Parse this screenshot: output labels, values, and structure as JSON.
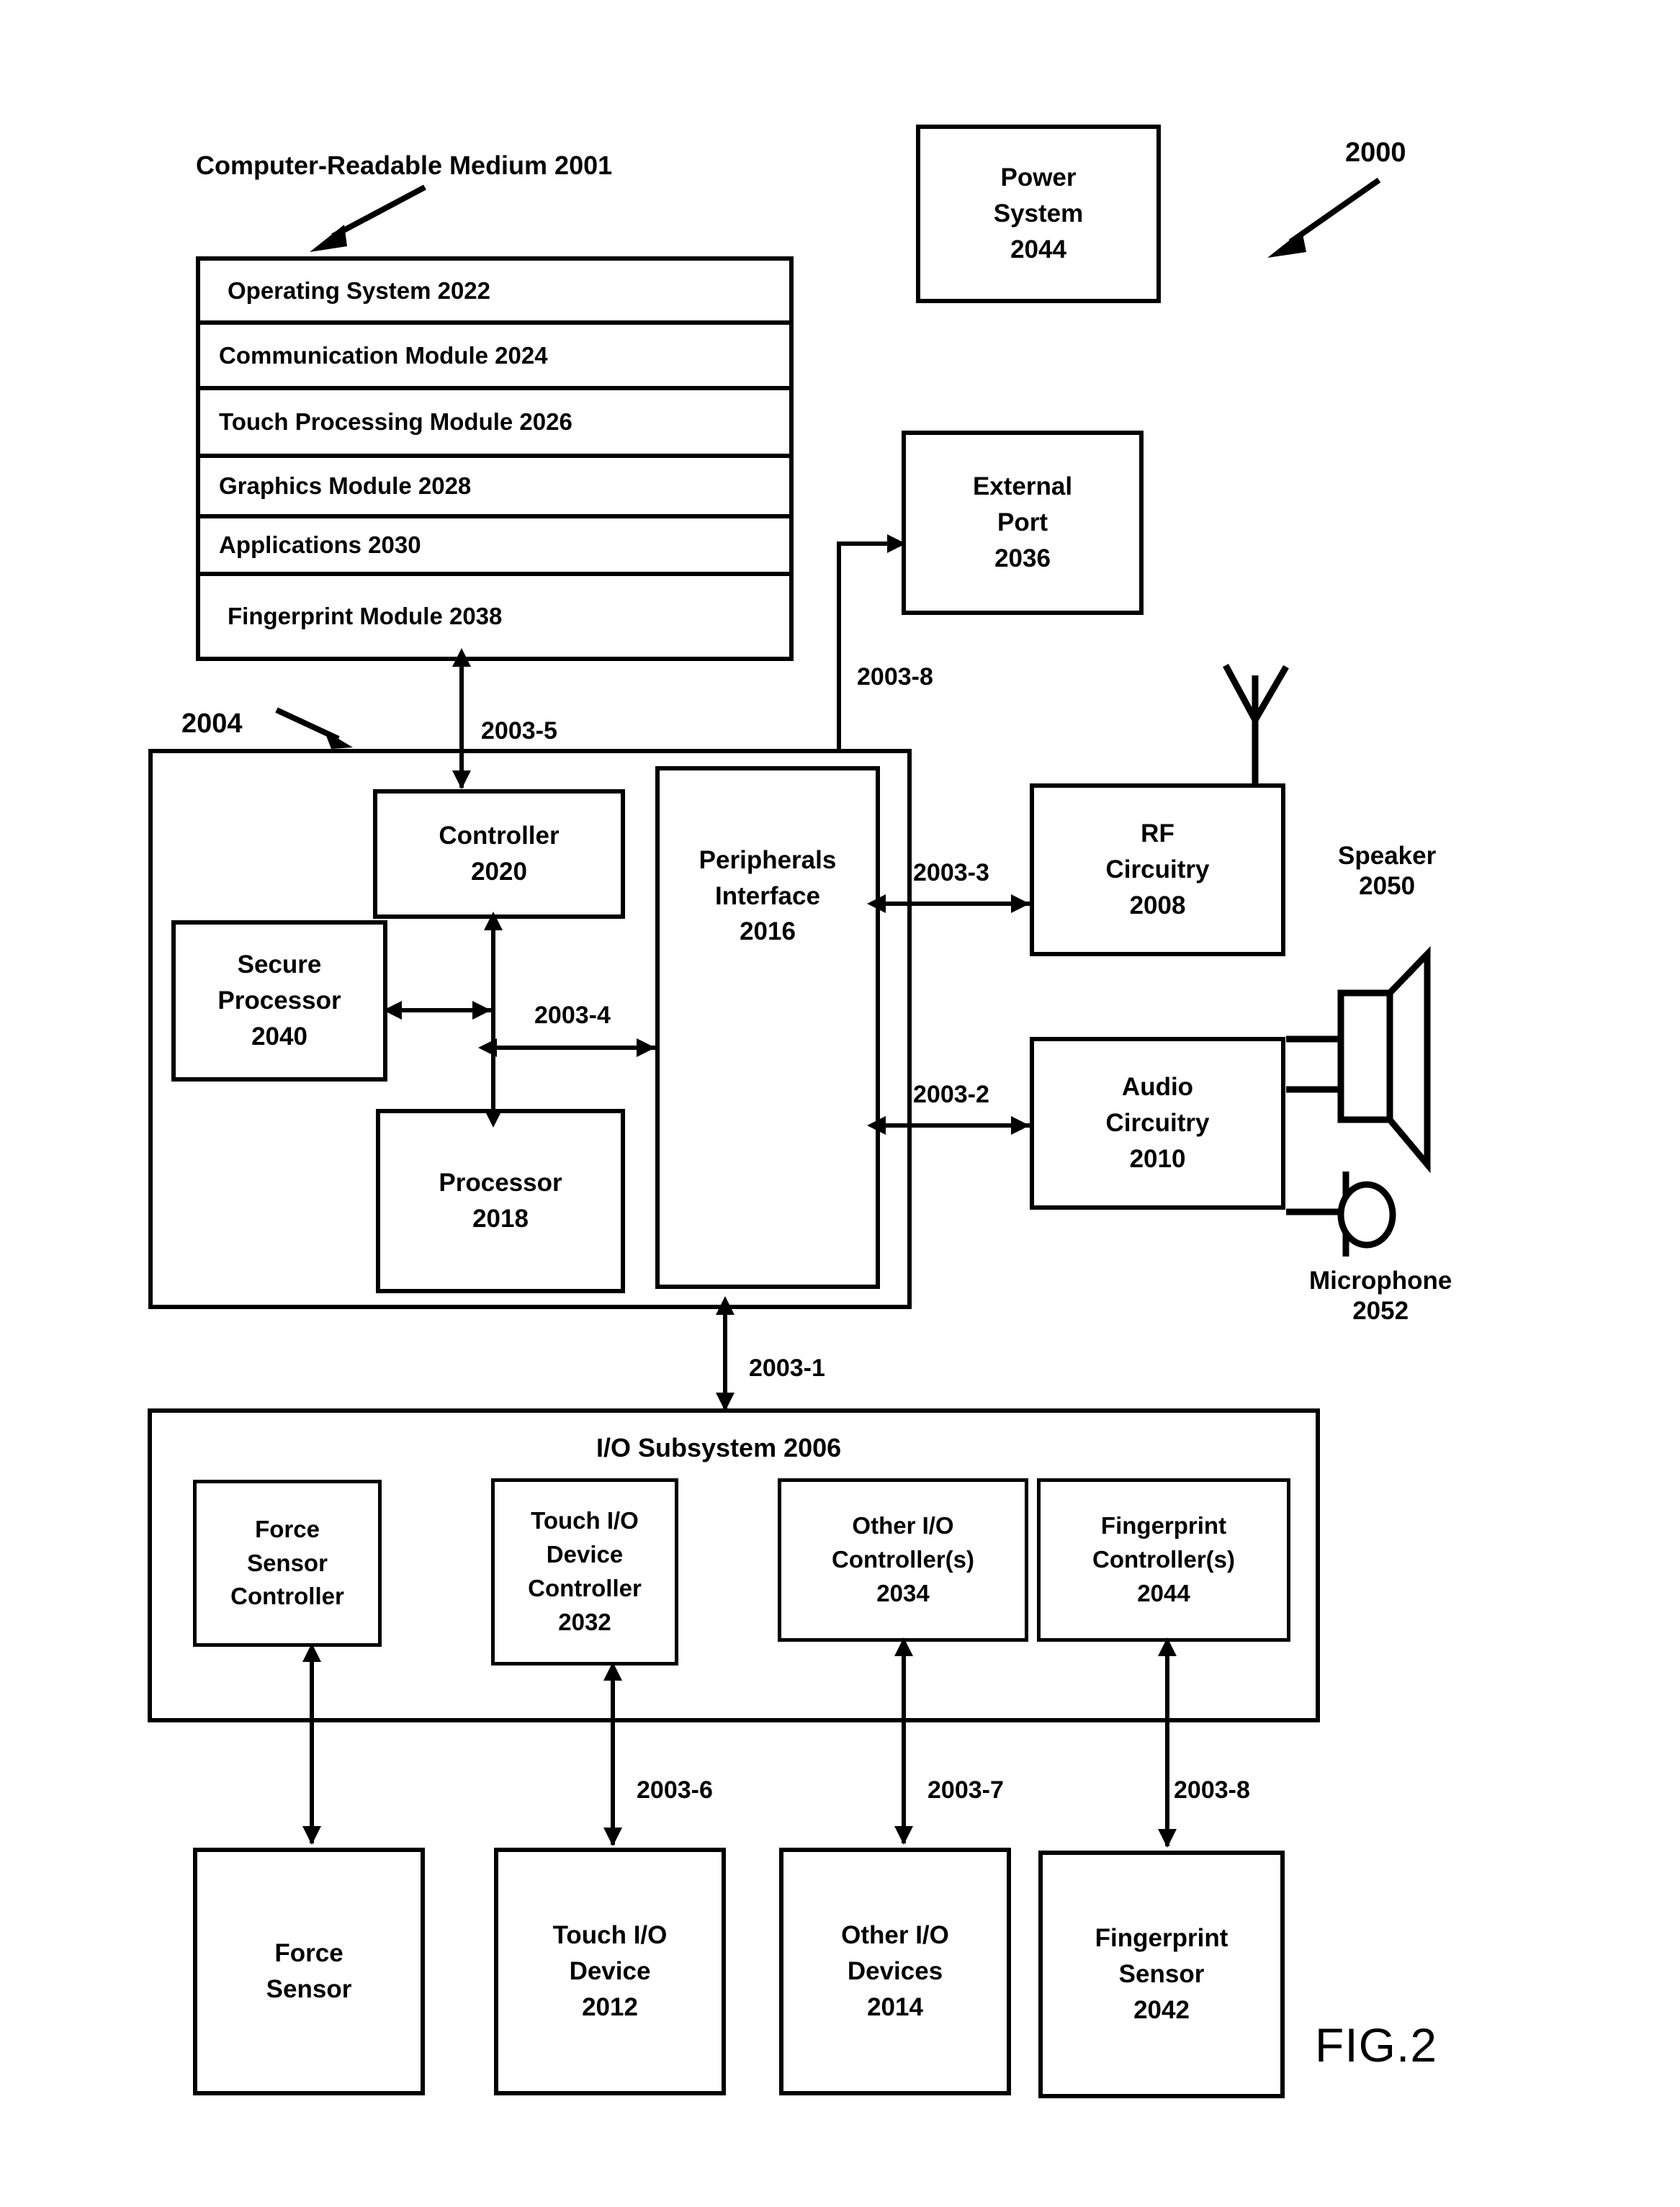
{
  "figure": {
    "label": "FIG.2",
    "system_ref": "2000",
    "medium_label": "Computer-Readable Medium 2001",
    "device_ref": "2004"
  },
  "memory_stack": {
    "items": [
      {
        "label": "Operating System 2022"
      },
      {
        "label": "Communication Module 2024"
      },
      {
        "label": "Touch Processing Module 2026"
      },
      {
        "label": "Graphics Module 2028"
      },
      {
        "label": "Applications 2030"
      },
      {
        "label": "Fingerprint Module 2038"
      }
    ]
  },
  "blocks": {
    "power_system": {
      "l1": "Power",
      "l2": "System",
      "l3": "2044"
    },
    "external_port": {
      "l1": "External",
      "l2": "Port",
      "l3": "2036"
    },
    "controller": {
      "l1": "Controller",
      "l2": "2020"
    },
    "secure_processor": {
      "l1": "Secure",
      "l2": "Processor",
      "l3": "2040"
    },
    "processor": {
      "l1": "Processor",
      "l2": "2018"
    },
    "peripherals_interface": {
      "l1": "Peripherals",
      "l2": "Interface",
      "l3": "2016"
    },
    "rf_circuitry": {
      "l1": "RF",
      "l2": "Circuitry",
      "l3": "2008"
    },
    "audio_circuitry": {
      "l1": "Audio",
      "l2": "Circuitry",
      "l3": "2010"
    },
    "io_subsystem": {
      "title": "I/O Subsystem 2006"
    },
    "force_sensor_controller": {
      "l1": "Force",
      "l2": "Sensor",
      "l3": "Controller"
    },
    "touch_io_device_controller": {
      "l1": "Touch I/O",
      "l2": "Device",
      "l3": "Controller",
      "l4": "2032"
    },
    "other_io_controllers": {
      "l1": "Other I/O",
      "l2": "Controller(s)",
      "l3": "2034"
    },
    "fingerprint_controllers": {
      "l1": "Fingerprint",
      "l2": "Controller(s)",
      "l3": "2044"
    },
    "force_sensor": {
      "l1": "Force",
      "l2": "Sensor"
    },
    "touch_io_device": {
      "l1": "Touch I/O",
      "l2": "Device",
      "l3": "2012"
    },
    "other_io_devices": {
      "l1": "Other I/O",
      "l2": "Devices",
      "l3": "2014"
    },
    "fingerprint_sensor": {
      "l1": "Fingerprint",
      "l2": "Sensor",
      "l3": "2042"
    }
  },
  "peripherals": {
    "speaker": {
      "l1": "Speaker",
      "l2": "2050"
    },
    "microphone": {
      "l1": "Microphone",
      "l2": "2052"
    }
  },
  "bus_labels": {
    "b1": "2003-1",
    "b2": "2003-2",
    "b3": "2003-3",
    "b4": "2003-4",
    "b5": "2003-5",
    "b6": "2003-6",
    "b7": "2003-7",
    "b8": "2003-8",
    "b8b": "2003-8"
  },
  "colors": {
    "ink": "#000000",
    "paper": "#ffffff"
  }
}
